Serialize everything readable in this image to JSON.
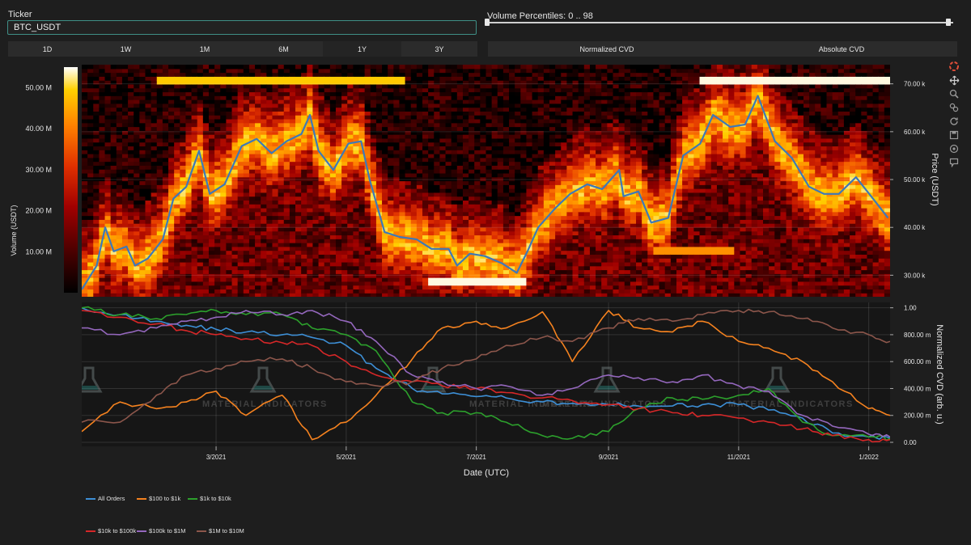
{
  "controls": {
    "ticker_label": "Ticker",
    "ticker_value": "BTC_USDT",
    "volume_percentiles_label": "Volume Percentiles: 0 .. 98",
    "range_buttons": [
      "1D",
      "1W",
      "1M",
      "6M",
      "1Y",
      "3Y"
    ],
    "cvd_buttons": [
      "Normalized CVD",
      "Absolute CVD"
    ],
    "selected_range": "3Y",
    "selected_cvd": "Normalized CVD"
  },
  "modebar": {
    "icons": [
      "plotly-logo-icon",
      "pan-icon",
      "zoom-icon",
      "compare-icon",
      "autoscale-icon",
      "download-icon",
      "reset-icon",
      "hover-icon"
    ]
  },
  "chart_data": [
    {
      "type": "heatmap",
      "title": "",
      "ylabel": "Price (USDT)",
      "colorbar_label": "Volume (USDT)",
      "colorbar_ticks": [
        "10.00 M",
        "20.00 M",
        "30.00 M",
        "40.00 M",
        "50.00 M"
      ],
      "colorbar_range": [
        0,
        55
      ],
      "y_ticks": [
        "30.00 k",
        "40.00 k",
        "50.00 k",
        "60.00 k",
        "70.00 k"
      ],
      "y_tick_values": [
        30000,
        40000,
        50000,
        60000,
        70000
      ],
      "ylim": [
        25500,
        74000
      ],
      "xlim": [
        "2020-12-28",
        "2022-01-11"
      ],
      "colorscale": [
        "#000000",
        "#4a0000",
        "#a00000",
        "#e03000",
        "#ff8000",
        "#ffd000",
        "#ffffff"
      ],
      "price_series": {
        "name": "Price",
        "color": "#3d79b9",
        "x": [
          "2020-12-28",
          "2021-01-04",
          "2021-01-08",
          "2021-01-12",
          "2021-01-18",
          "2021-01-22",
          "2021-01-28",
          "2021-02-04",
          "2021-02-09",
          "2021-02-15",
          "2021-02-21",
          "2021-02-26",
          "2021-03-05",
          "2021-03-13",
          "2021-03-20",
          "2021-03-27",
          "2021-04-03",
          "2021-04-10",
          "2021-04-14",
          "2021-04-18",
          "2021-04-25",
          "2021-05-02",
          "2021-05-08",
          "2021-05-12",
          "2021-05-19",
          "2021-05-26",
          "2021-06-03",
          "2021-06-10",
          "2021-06-18",
          "2021-06-22",
          "2021-06-28",
          "2021-07-05",
          "2021-07-13",
          "2021-07-20",
          "2021-07-25",
          "2021-07-30",
          "2021-08-07",
          "2021-08-14",
          "2021-08-22",
          "2021-08-29",
          "2021-09-06",
          "2021-09-08",
          "2021-09-15",
          "2021-09-21",
          "2021-09-29",
          "2021-10-06",
          "2021-10-14",
          "2021-10-20",
          "2021-10-28",
          "2021-11-04",
          "2021-11-10",
          "2021-11-18",
          "2021-11-26",
          "2021-12-04",
          "2021-12-11",
          "2021-12-18",
          "2021-12-26",
          "2022-01-03",
          "2022-01-10"
        ],
        "y": [
          27000,
          32000,
          40000,
          35000,
          36000,
          32000,
          33500,
          37500,
          46000,
          48500,
          56000,
          47000,
          49000,
          57000,
          58500,
          55500,
          58000,
          59500,
          63500,
          56000,
          52000,
          57500,
          58000,
          50000,
          39000,
          38000,
          37500,
          35500,
          35500,
          32000,
          34500,
          34000,
          32500,
          30500,
          35000,
          40000,
          44000,
          47000,
          49000,
          48000,
          52000,
          46500,
          47500,
          41000,
          42000,
          55000,
          57500,
          63500,
          61000,
          61500,
          67500,
          58000,
          54500,
          48500,
          47000,
          47000,
          50500,
          46000,
          42000
        ]
      },
      "notable_bands": [
        {
          "price": 70500,
          "start": "2021-01-31",
          "end": "2021-05-29",
          "level": "high"
        },
        {
          "price": 71000,
          "start": "2021-10-14",
          "end": "2022-01-11",
          "level": "max"
        },
        {
          "price": 29000,
          "start": "2021-06-08",
          "end": "2021-07-24",
          "level": "max"
        },
        {
          "price": 35000,
          "start": "2021-09-22",
          "end": "2021-10-30",
          "level": "mid"
        }
      ]
    },
    {
      "type": "line",
      "title": "",
      "xlabel": "Date (UTC)",
      "ylabel": "Normalized CVD (arb. u.)",
      "x_ticks": [
        "3/2021",
        "5/2021",
        "7/2021",
        "9/2021",
        "11/2021",
        "1/2022"
      ],
      "x_tick_values": [
        "2021-03-01",
        "2021-05-01",
        "2021-07-01",
        "2021-09-01",
        "2021-11-01",
        "2022-01-01"
      ],
      "y_ticks": [
        "0.00",
        "200.00 m",
        "400.00 m",
        "600.00 m",
        "800.00 m",
        "1.00"
      ],
      "y_tick_values": [
        0,
        0.2,
        0.4,
        0.6,
        0.8,
        1.0
      ],
      "ylim": [
        -0.03,
        1.04
      ],
      "xlim": [
        "2020-12-28",
        "2022-01-11"
      ],
      "legend_placement": "bottom-left",
      "x": [
        "2020-12-28",
        "2021-01-15",
        "2021-02-01",
        "2021-02-15",
        "2021-03-01",
        "2021-03-15",
        "2021-04-01",
        "2021-04-15",
        "2021-05-01",
        "2021-05-15",
        "2021-06-01",
        "2021-06-15",
        "2021-07-01",
        "2021-07-15",
        "2021-08-01",
        "2021-08-15",
        "2021-09-01",
        "2021-09-15",
        "2021-10-01",
        "2021-10-15",
        "2021-11-01",
        "2021-11-15",
        "2021-12-01",
        "2021-12-15",
        "2022-01-01",
        "2022-01-11"
      ],
      "series": [
        {
          "name": "All Orders",
          "color": "#3d8fd6",
          "values": [
            1.0,
            0.95,
            0.9,
            0.87,
            0.84,
            0.82,
            0.8,
            0.78,
            0.72,
            0.55,
            0.4,
            0.36,
            0.34,
            0.33,
            0.3,
            0.29,
            0.28,
            0.27,
            0.27,
            0.28,
            0.28,
            0.24,
            0.18,
            0.07,
            0.04,
            0.03
          ]
        },
        {
          "name": "$100 to $1k",
          "color": "#f5821f",
          "values": [
            0.08,
            0.3,
            0.25,
            0.3,
            0.38,
            0.2,
            0.35,
            0.02,
            0.15,
            0.35,
            0.62,
            0.85,
            0.9,
            0.85,
            0.97,
            0.6,
            0.98,
            0.85,
            0.82,
            0.9,
            0.75,
            0.7,
            0.6,
            0.45,
            0.25,
            0.2
          ]
        },
        {
          "name": "$1k to $10k",
          "color": "#2ca02c",
          "values": [
            1.0,
            0.95,
            0.92,
            0.95,
            0.98,
            0.95,
            0.95,
            0.85,
            0.8,
            0.68,
            0.3,
            0.22,
            0.22,
            0.15,
            0.05,
            0.03,
            0.08,
            0.25,
            0.33,
            0.32,
            0.35,
            0.4,
            0.15,
            0.05,
            0.04,
            0.03
          ]
        },
        {
          "name": "$10k to $100k",
          "color": "#d62728",
          "values": [
            0.98,
            0.93,
            0.88,
            0.83,
            0.8,
            0.77,
            0.74,
            0.72,
            0.6,
            0.5,
            0.45,
            0.42,
            0.4,
            0.37,
            0.33,
            0.31,
            0.28,
            0.25,
            0.22,
            0.2,
            0.18,
            0.15,
            0.1,
            0.05,
            0.02,
            0.02
          ]
        },
        {
          "name": "$100k to $1M",
          "color": "#9467bd",
          "values": [
            0.85,
            0.8,
            0.85,
            0.9,
            0.93,
            0.98,
            0.95,
            0.98,
            0.9,
            0.75,
            0.5,
            0.45,
            0.4,
            0.42,
            0.35,
            0.4,
            0.5,
            0.48,
            0.45,
            0.5,
            0.42,
            0.38,
            0.2,
            0.12,
            0.06,
            0.04
          ]
        },
        {
          "name": "$1M to $10M",
          "color": "#8c564b",
          "values": [
            0.15,
            0.15,
            0.35,
            0.5,
            0.55,
            0.6,
            0.62,
            0.55,
            0.45,
            0.42,
            0.45,
            0.55,
            0.62,
            0.72,
            0.78,
            0.75,
            0.85,
            0.92,
            0.9,
            0.95,
            0.98,
            0.97,
            0.92,
            0.85,
            0.8,
            0.75
          ]
        }
      ]
    }
  ],
  "watermark": {
    "text": "MATERIAL INDICATORS"
  }
}
